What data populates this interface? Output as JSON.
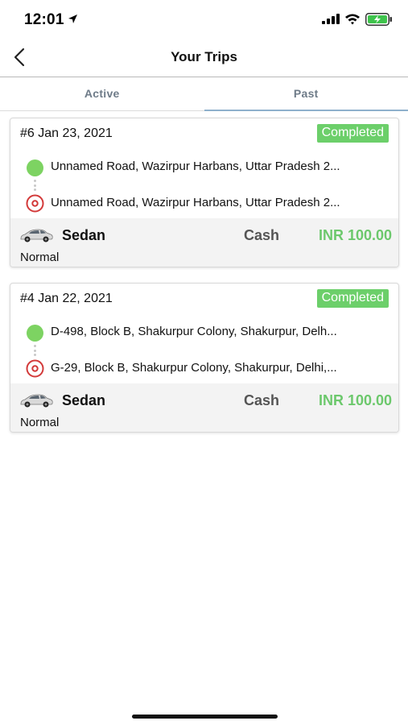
{
  "status_bar": {
    "time": "12:01"
  },
  "nav": {
    "title": "Your Trips"
  },
  "tabs": [
    {
      "label": "Active",
      "selected": false
    },
    {
      "label": "Past",
      "selected": true
    }
  ],
  "trips": [
    {
      "header": "#6 Jan 23, 2021",
      "status": "Completed",
      "pickup": "Unnamed Road, Wazirpur Harbans, Uttar Pradesh 2...",
      "dropoff": "Unnamed Road, Wazirpur Harbans, Uttar Pradesh 2...",
      "vehicle": "Sedan",
      "service": "Normal",
      "payment": "Cash",
      "amount": "INR 100.00"
    },
    {
      "header": "#4 Jan 22, 2021",
      "status": "Completed",
      "pickup": "D-498, Block B, Shakurpur Colony, Shakurpur, Delh...",
      "dropoff": "G-29, Block B, Shakurpur Colony, Shakurpur, Delhi,...",
      "vehicle": "Sedan",
      "service": "Normal",
      "payment": "Cash",
      "amount": "INR 100.00"
    }
  ],
  "colors": {
    "status_badge": "#6ccf6a",
    "amount": "#6cc86c",
    "pickup_marker": "#7dd362",
    "dropoff_marker": "#d33a3a",
    "tab_indicator": "#8fb0cc"
  },
  "icons": {
    "back": "chevron-left-icon",
    "pickup": "green-dot-icon",
    "dropoff": "target-pin-icon",
    "vehicle": "sedan-car-icon"
  }
}
